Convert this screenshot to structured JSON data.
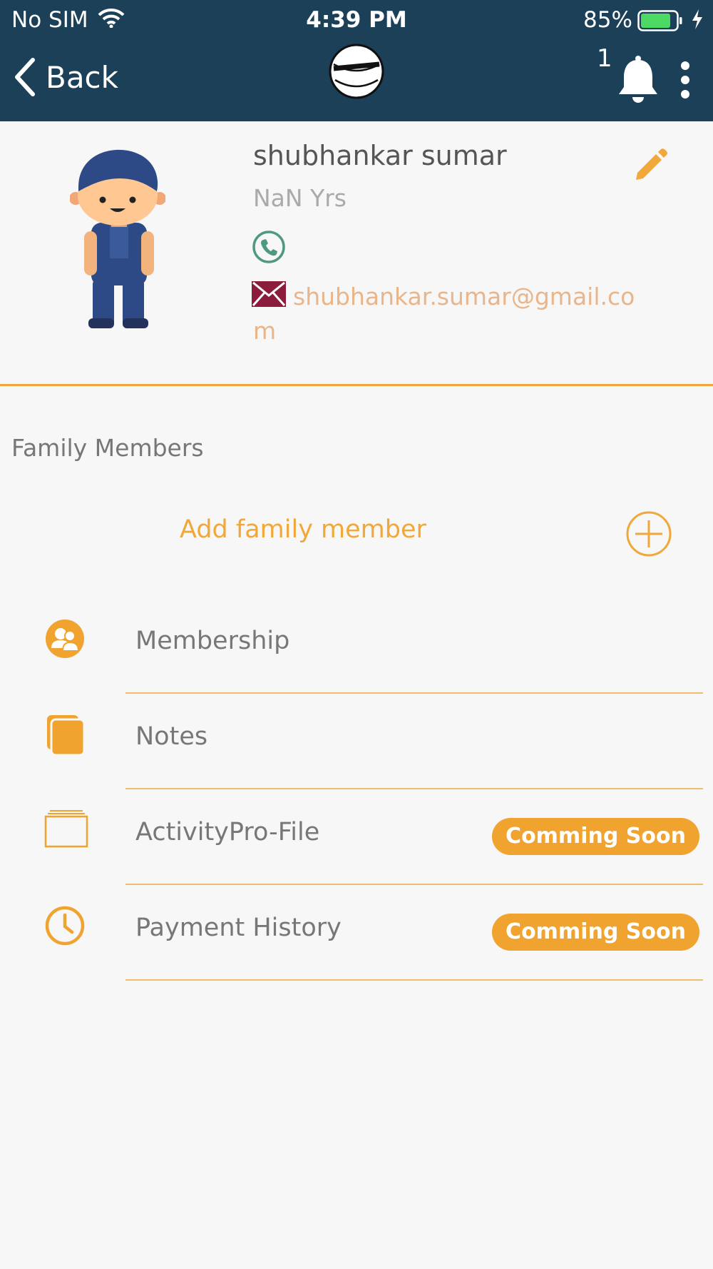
{
  "status_bar": {
    "carrier": "No SIM",
    "time": "4:39 PM",
    "battery_percent": "85%",
    "battery_level": 0.85
  },
  "nav": {
    "back_label": "Back",
    "notification_count": "1"
  },
  "profile": {
    "name": "shubhankar sumar",
    "age": "NaN Yrs",
    "email": "shubhankar.sumar@gmail.com"
  },
  "family": {
    "title": "Family Members",
    "add_label": "Add family member"
  },
  "menu": [
    {
      "label": "Membership",
      "icon": "membership-icon",
      "badge": ""
    },
    {
      "label": "Notes",
      "icon": "notes-icon",
      "badge": ""
    },
    {
      "label": "ActivityPro-File",
      "icon": "folder-icon",
      "badge": "Comming Soon"
    },
    {
      "label": "Payment History",
      "icon": "clock-icon",
      "badge": "Comming Soon"
    }
  ],
  "colors": {
    "header": "#1c4058",
    "accent": "#f0a83a",
    "email": "#e9b58a",
    "phone": "#4f9a7e",
    "mail_icon": "#8b1c3c"
  }
}
